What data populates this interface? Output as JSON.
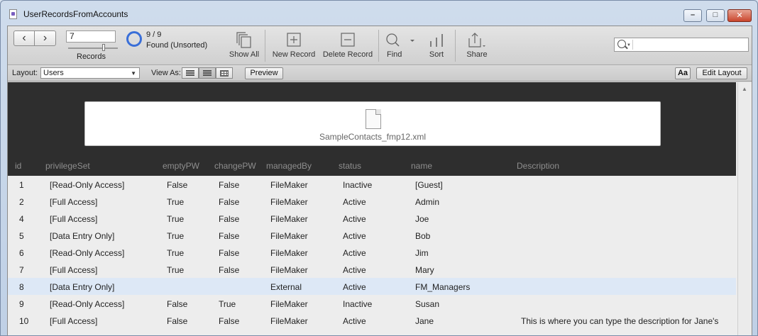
{
  "window": {
    "title": "UserRecordsFromAccounts",
    "min_glyph": "–",
    "max_glyph": "□",
    "close_glyph": "✕"
  },
  "toolbar": {
    "record_number": "7",
    "records_label": "Records",
    "found_count": "9 / 9",
    "found_state": "Found (Unsorted)",
    "show_all": "Show All",
    "new_record": "New Record",
    "delete_record": "Delete Record",
    "find": "Find",
    "sort": "Sort",
    "share": "Share",
    "search_value": ""
  },
  "layoutbar": {
    "layout_label": "Layout:",
    "layout_value": "Users",
    "view_as_label": "View As:",
    "preview": "Preview",
    "aa": "Aa",
    "edit_layout": "Edit Layout"
  },
  "header": {
    "filename": "SampleContacts_fmp12.xml",
    "columns": [
      "id",
      "privilegeSet",
      "emptyPW",
      "changePW",
      "managedBy",
      "status",
      "name",
      "Description"
    ]
  },
  "rows": [
    {
      "id": "1",
      "privilegeSet": "[Read-Only Access]",
      "emptyPW": "False",
      "changePW": "False",
      "managedBy": "FileMaker",
      "status": "Inactive",
      "name": "[Guest]",
      "description": ""
    },
    {
      "id": "2",
      "privilegeSet": "[Full Access]",
      "emptyPW": "True",
      "changePW": "False",
      "managedBy": "FileMaker",
      "status": "Active",
      "name": "Admin",
      "description": ""
    },
    {
      "id": "4",
      "privilegeSet": "[Full Access]",
      "emptyPW": "True",
      "changePW": "False",
      "managedBy": "FileMaker",
      "status": "Active",
      "name": "Joe",
      "description": ""
    },
    {
      "id": "5",
      "privilegeSet": "[Data Entry Only]",
      "emptyPW": "True",
      "changePW": "False",
      "managedBy": "FileMaker",
      "status": "Active",
      "name": "Bob",
      "description": ""
    },
    {
      "id": "6",
      "privilegeSet": "[Read-Only Access]",
      "emptyPW": "True",
      "changePW": "False",
      "managedBy": "FileMaker",
      "status": "Active",
      "name": "Jim",
      "description": ""
    },
    {
      "id": "7",
      "privilegeSet": "[Full Access]",
      "emptyPW": "True",
      "changePW": "False",
      "managedBy": "FileMaker",
      "status": "Active",
      "name": "Mary",
      "description": ""
    },
    {
      "id": "8",
      "privilegeSet": "[Data Entry Only]",
      "emptyPW": "",
      "changePW": "",
      "managedBy": "External",
      "status": "Active",
      "name": "FM_Managers",
      "description": "",
      "selected": true
    },
    {
      "id": "9",
      "privilegeSet": "[Read-Only Access]",
      "emptyPW": "False",
      "changePW": "True",
      "managedBy": "FileMaker",
      "status": "Inactive",
      "name": "Susan",
      "description": ""
    },
    {
      "id": "10",
      "privilegeSet": "[Full Access]",
      "emptyPW": "False",
      "changePW": "False",
      "managedBy": "FileMaker",
      "status": "Active",
      "name": "Jane",
      "description": "This is where you can type the description for Jane's"
    }
  ]
}
